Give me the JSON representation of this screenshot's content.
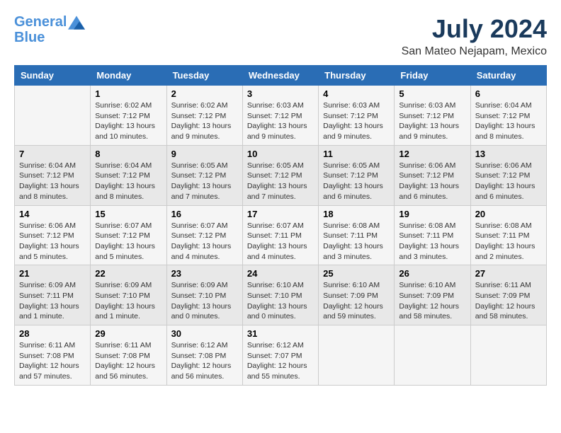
{
  "header": {
    "logo_line1": "General",
    "logo_line2": "Blue",
    "month_title": "July 2024",
    "location": "San Mateo Nejapam, Mexico"
  },
  "days_of_week": [
    "Sunday",
    "Monday",
    "Tuesday",
    "Wednesday",
    "Thursday",
    "Friday",
    "Saturday"
  ],
  "weeks": [
    [
      {
        "day": "",
        "info": ""
      },
      {
        "day": "1",
        "info": "Sunrise: 6:02 AM\nSunset: 7:12 PM\nDaylight: 13 hours\nand 10 minutes."
      },
      {
        "day": "2",
        "info": "Sunrise: 6:02 AM\nSunset: 7:12 PM\nDaylight: 13 hours\nand 9 minutes."
      },
      {
        "day": "3",
        "info": "Sunrise: 6:03 AM\nSunset: 7:12 PM\nDaylight: 13 hours\nand 9 minutes."
      },
      {
        "day": "4",
        "info": "Sunrise: 6:03 AM\nSunset: 7:12 PM\nDaylight: 13 hours\nand 9 minutes."
      },
      {
        "day": "5",
        "info": "Sunrise: 6:03 AM\nSunset: 7:12 PM\nDaylight: 13 hours\nand 9 minutes."
      },
      {
        "day": "6",
        "info": "Sunrise: 6:04 AM\nSunset: 7:12 PM\nDaylight: 13 hours\nand 8 minutes."
      }
    ],
    [
      {
        "day": "7",
        "info": "Sunrise: 6:04 AM\nSunset: 7:12 PM\nDaylight: 13 hours\nand 8 minutes."
      },
      {
        "day": "8",
        "info": "Sunrise: 6:04 AM\nSunset: 7:12 PM\nDaylight: 13 hours\nand 8 minutes."
      },
      {
        "day": "9",
        "info": "Sunrise: 6:05 AM\nSunset: 7:12 PM\nDaylight: 13 hours\nand 7 minutes."
      },
      {
        "day": "10",
        "info": "Sunrise: 6:05 AM\nSunset: 7:12 PM\nDaylight: 13 hours\nand 7 minutes."
      },
      {
        "day": "11",
        "info": "Sunrise: 6:05 AM\nSunset: 7:12 PM\nDaylight: 13 hours\nand 6 minutes."
      },
      {
        "day": "12",
        "info": "Sunrise: 6:06 AM\nSunset: 7:12 PM\nDaylight: 13 hours\nand 6 minutes."
      },
      {
        "day": "13",
        "info": "Sunrise: 6:06 AM\nSunset: 7:12 PM\nDaylight: 13 hours\nand 6 minutes."
      }
    ],
    [
      {
        "day": "14",
        "info": "Sunrise: 6:06 AM\nSunset: 7:12 PM\nDaylight: 13 hours\nand 5 minutes."
      },
      {
        "day": "15",
        "info": "Sunrise: 6:07 AM\nSunset: 7:12 PM\nDaylight: 13 hours\nand 5 minutes."
      },
      {
        "day": "16",
        "info": "Sunrise: 6:07 AM\nSunset: 7:12 PM\nDaylight: 13 hours\nand 4 minutes."
      },
      {
        "day": "17",
        "info": "Sunrise: 6:07 AM\nSunset: 7:11 PM\nDaylight: 13 hours\nand 4 minutes."
      },
      {
        "day": "18",
        "info": "Sunrise: 6:08 AM\nSunset: 7:11 PM\nDaylight: 13 hours\nand 3 minutes."
      },
      {
        "day": "19",
        "info": "Sunrise: 6:08 AM\nSunset: 7:11 PM\nDaylight: 13 hours\nand 3 minutes."
      },
      {
        "day": "20",
        "info": "Sunrise: 6:08 AM\nSunset: 7:11 PM\nDaylight: 13 hours\nand 2 minutes."
      }
    ],
    [
      {
        "day": "21",
        "info": "Sunrise: 6:09 AM\nSunset: 7:11 PM\nDaylight: 13 hours\nand 1 minute."
      },
      {
        "day": "22",
        "info": "Sunrise: 6:09 AM\nSunset: 7:10 PM\nDaylight: 13 hours\nand 1 minute."
      },
      {
        "day": "23",
        "info": "Sunrise: 6:09 AM\nSunset: 7:10 PM\nDaylight: 13 hours\nand 0 minutes."
      },
      {
        "day": "24",
        "info": "Sunrise: 6:10 AM\nSunset: 7:10 PM\nDaylight: 13 hours\nand 0 minutes."
      },
      {
        "day": "25",
        "info": "Sunrise: 6:10 AM\nSunset: 7:09 PM\nDaylight: 12 hours\nand 59 minutes."
      },
      {
        "day": "26",
        "info": "Sunrise: 6:10 AM\nSunset: 7:09 PM\nDaylight: 12 hours\nand 58 minutes."
      },
      {
        "day": "27",
        "info": "Sunrise: 6:11 AM\nSunset: 7:09 PM\nDaylight: 12 hours\nand 58 minutes."
      }
    ],
    [
      {
        "day": "28",
        "info": "Sunrise: 6:11 AM\nSunset: 7:08 PM\nDaylight: 12 hours\nand 57 minutes."
      },
      {
        "day": "29",
        "info": "Sunrise: 6:11 AM\nSunset: 7:08 PM\nDaylight: 12 hours\nand 56 minutes."
      },
      {
        "day": "30",
        "info": "Sunrise: 6:12 AM\nSunset: 7:08 PM\nDaylight: 12 hours\nand 56 minutes."
      },
      {
        "day": "31",
        "info": "Sunrise: 6:12 AM\nSunset: 7:07 PM\nDaylight: 12 hours\nand 55 minutes."
      },
      {
        "day": "",
        "info": ""
      },
      {
        "day": "",
        "info": ""
      },
      {
        "day": "",
        "info": ""
      }
    ]
  ]
}
